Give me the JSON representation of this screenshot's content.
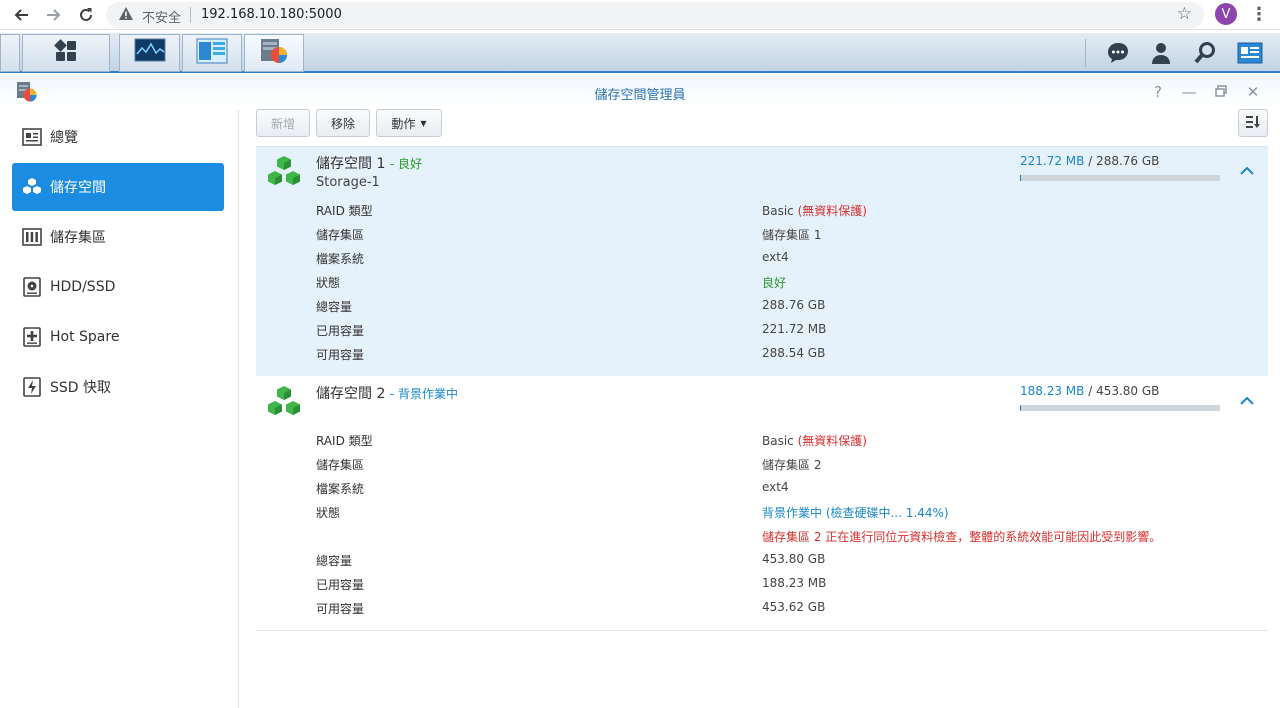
{
  "browser": {
    "insecure_label": "不安全",
    "url": "192.168.10.180:5000",
    "profile_initial": "V"
  },
  "window": {
    "title": "儲存空間管理員"
  },
  "sidebar": {
    "items": [
      {
        "label": "總覽",
        "icon": "overview-icon"
      },
      {
        "label": "儲存空間",
        "icon": "volume-icon"
      },
      {
        "label": "儲存集區",
        "icon": "storage-pool-icon"
      },
      {
        "label": "HDD/SSD",
        "icon": "hdd-icon"
      },
      {
        "label": "Hot Spare",
        "icon": "hot-spare-icon"
      },
      {
        "label": "SSD 快取",
        "icon": "ssd-cache-icon"
      }
    ]
  },
  "toolbar": {
    "create_label": "新增",
    "remove_label": "移除",
    "action_label": "動作"
  },
  "volumes": [
    {
      "name": "儲存空間 1",
      "status": "- 良好",
      "description": "Storage-1",
      "used": "221.72 MB",
      "total": "/ 288.76 GB",
      "usage_fraction": 0.0008,
      "props": {
        "raid_label": "RAID 類型",
        "raid_value": "Basic",
        "raid_note": "(無資料保護)",
        "pool_label": "儲存集區",
        "pool_value": "儲存集區 1",
        "fs_label": "檔案系統",
        "fs_value": "ext4",
        "state_label": "狀態",
        "state_value": "良好",
        "total_label": "總容量",
        "total_value": "288.76 GB",
        "used_label": "已用容量",
        "used_value": "221.72 MB",
        "free_label": "可用容量",
        "free_value": "288.54 GB"
      }
    },
    {
      "name": "儲存空間 2",
      "status": "- 背景作業中",
      "used": "188.23 MB",
      "total": "/ 453.80 GB",
      "usage_fraction": 0.0004,
      "props": {
        "raid_label": "RAID 類型",
        "raid_value": "Basic",
        "raid_note": "(無資料保護)",
        "pool_label": "儲存集區",
        "pool_value": "儲存集區 2",
        "fs_label": "檔案系統",
        "fs_value": "ext4",
        "state_label": "狀態",
        "state_value": "背景作業中 (檢查硬碟中... 1.44%)",
        "state_warning": "儲存集區 2 正在進行同位元資料檢查，整體的系統效能可能因此受到影響。",
        "total_label": "總容量",
        "total_value": "453.80 GB",
        "used_label": "已用容量",
        "used_value": "188.23 MB",
        "free_label": "可用容量",
        "free_value": "453.62 GB"
      }
    }
  ],
  "colors": {
    "accent": "#1c8ce3",
    "good": "#2a9d2a",
    "warning": "#d9302e",
    "info": "#1c86cc"
  }
}
